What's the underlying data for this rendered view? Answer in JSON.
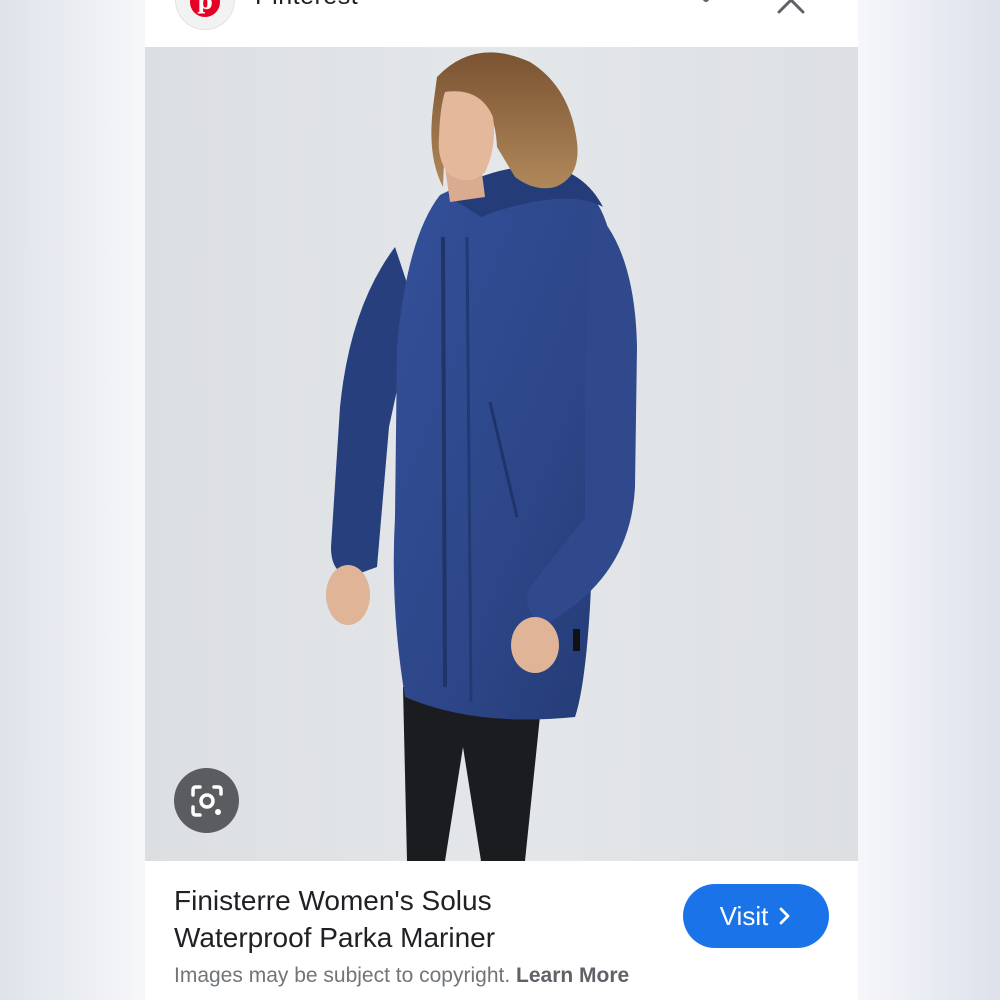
{
  "header": {
    "site_name": "Pinterest",
    "logo_letter": "p",
    "logo_icon": "pinterest-logo-icon",
    "more_icon": "more-vert-icon",
    "close_icon": "close-icon"
  },
  "image": {
    "lens_icon": "google-lens-icon"
  },
  "result": {
    "title_line1": "Finisterre Women's Solus",
    "title_line2": "Waterproof Parka Mariner",
    "visit_label": "Visit",
    "visit_icon": "chevron-right-icon",
    "copyright_text": "Images may be subject to copyright.",
    "learn_more": "Learn More"
  },
  "colors": {
    "brand_pinterest": "#e60023",
    "accent_blue": "#1a73e8",
    "jacket_navy": "#2d4688"
  }
}
